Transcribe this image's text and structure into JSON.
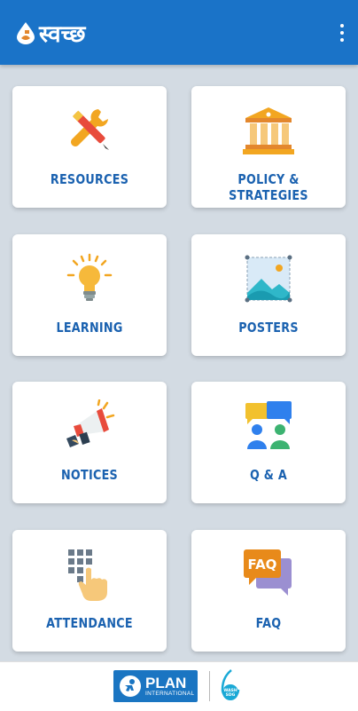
{
  "app": {
    "title": "स्वच्छ"
  },
  "cards": [
    {
      "label": "RESOURCES",
      "icon": "tools-icon"
    },
    {
      "label": "POLICY & STRATEGIES",
      "icon": "government-building-icon"
    },
    {
      "label": "LEARNING",
      "icon": "lightbulb-icon"
    },
    {
      "label": "POSTERS",
      "icon": "image-icon"
    },
    {
      "label": "NOTICES",
      "icon": "megaphone-icon"
    },
    {
      "label": "Q & A",
      "icon": "group-chat-icon"
    },
    {
      "label": "ATTENDANCE",
      "icon": "keypad-tap-icon"
    },
    {
      "label": "FAQ",
      "icon": "faq-bubbles-icon"
    }
  ],
  "footer": {
    "plan_name": "PLAN",
    "plan_sub": "INTERNATIONAL",
    "wash_text": "WASH SDG"
  },
  "colors": {
    "appbar": "#1a73c8",
    "background": "#d3dbe3",
    "card_label": "#1b62b0"
  }
}
